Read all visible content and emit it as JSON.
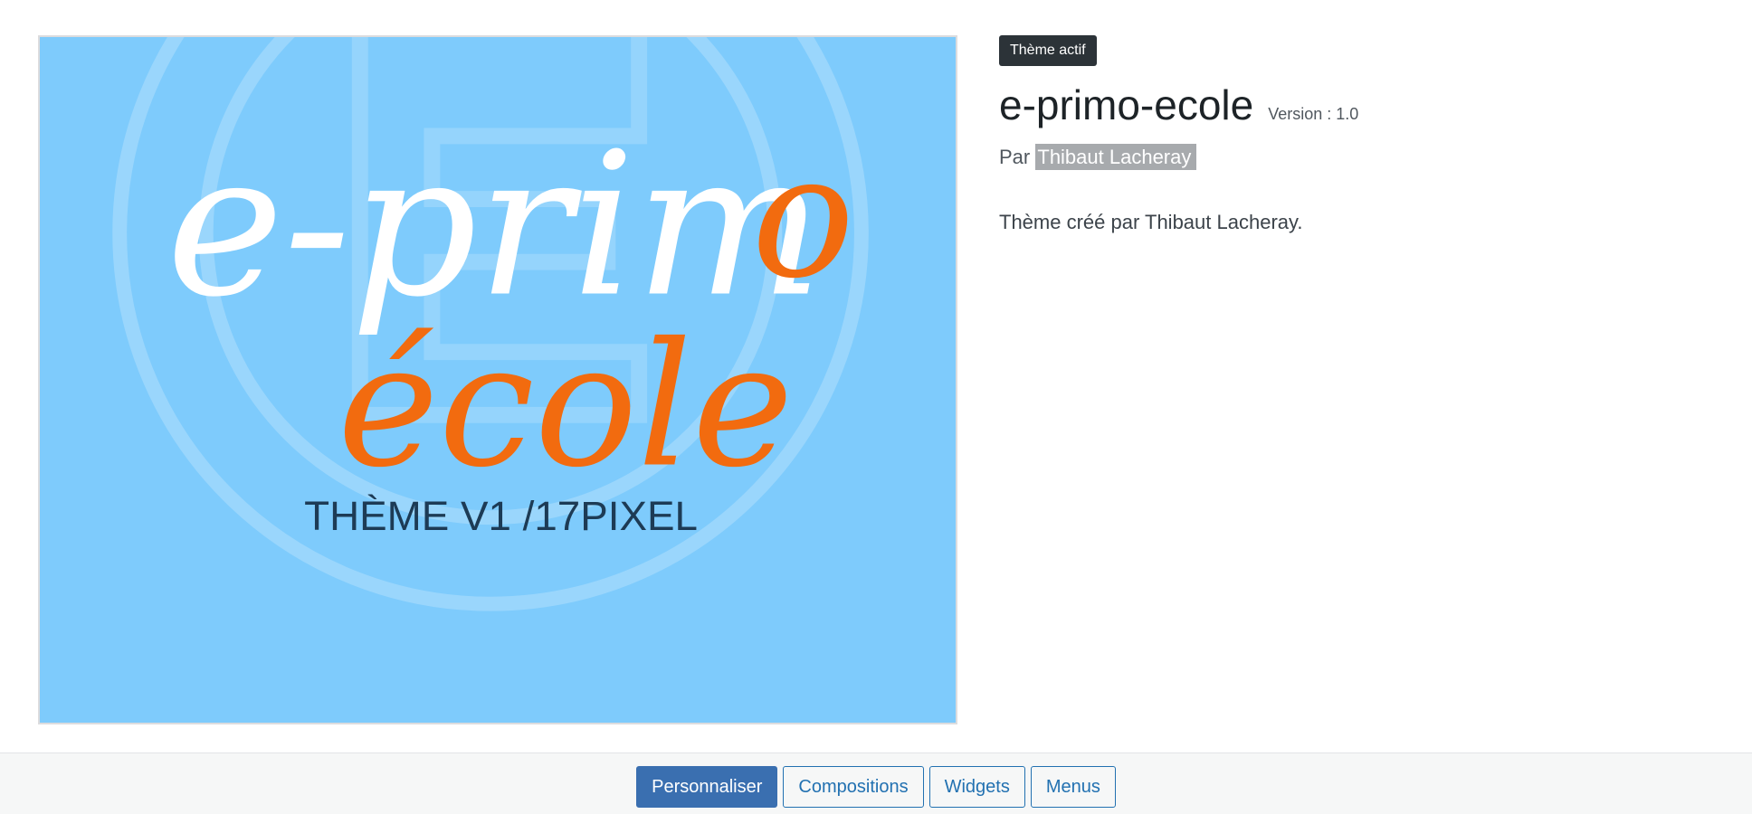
{
  "theme": {
    "badge": "Thème actif",
    "name": "e-primo-ecole",
    "version_label": "Version : 1.0",
    "author_prefix": "Par",
    "author_name": "Thibaut Lacheray",
    "description": "Thème créé par Thibaut Lacheray."
  },
  "screenshot": {
    "logo_line1": "e-prim",
    "logo_letter_o": "o",
    "logo_line2": "école",
    "caption": "THÈME V1 /17PIXEL",
    "bg_color": "#7ecbfc",
    "accent_color": "#f26b0f",
    "white_color": "#ffffff",
    "caption_color": "#1d3b55"
  },
  "actions": {
    "customize": "Personnaliser",
    "compositions": "Compositions",
    "widgets": "Widgets",
    "menus": "Menus"
  }
}
